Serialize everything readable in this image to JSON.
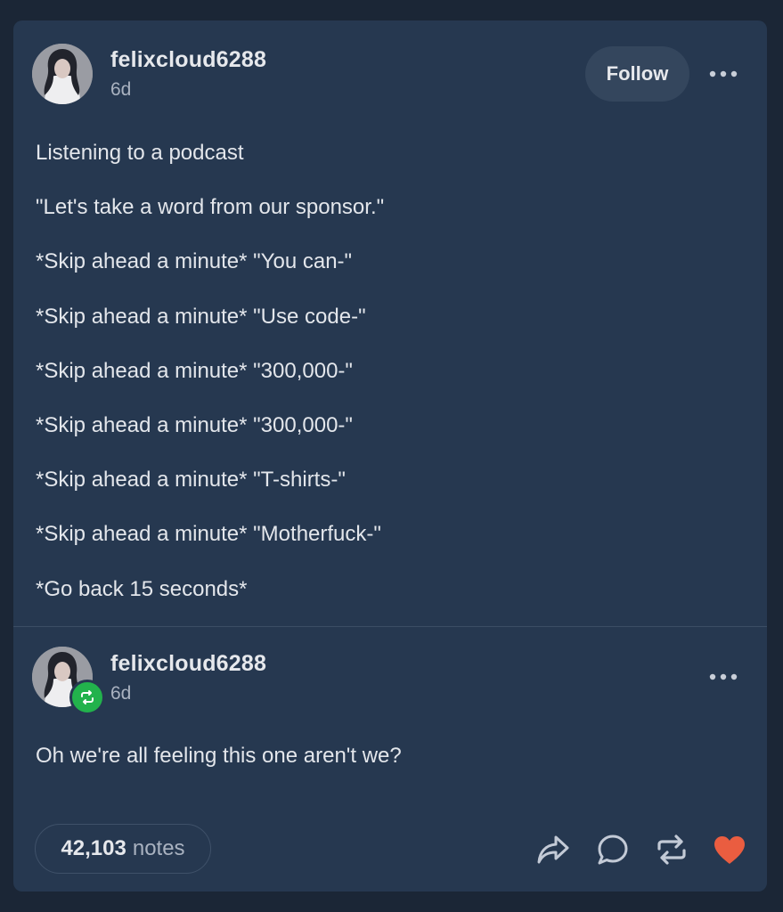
{
  "post": {
    "author": "felixcloud6288",
    "time": "6d",
    "follow_label": "Follow",
    "lines": [
      "Listening to a podcast",
      "\"Let's take a word from our sponsor.\"",
      "*Skip ahead a minute* \"You can-\"",
      "*Skip ahead a minute* \"Use code-\"",
      "*Skip ahead a minute* \"300,000-\"",
      "*Skip ahead a minute* \"300,000-\"",
      "*Skip ahead a minute* \"T-shirts-\"",
      "*Skip ahead a minute* \"Motherfuck-\"",
      "*Go back 15 seconds*"
    ]
  },
  "reblog": {
    "author": "felixcloud6288",
    "time": "6d",
    "text": "Oh we're all feeling this one aren't we?"
  },
  "footer": {
    "notes_count": "42,103",
    "notes_label": "notes",
    "icons": [
      "share-icon",
      "reply-icon",
      "reblog-icon",
      "like-icon"
    ]
  },
  "colors": {
    "background": "#1b2636",
    "card": "#263850",
    "like": "#ea5d40",
    "reblog_badge": "#22b24c"
  }
}
